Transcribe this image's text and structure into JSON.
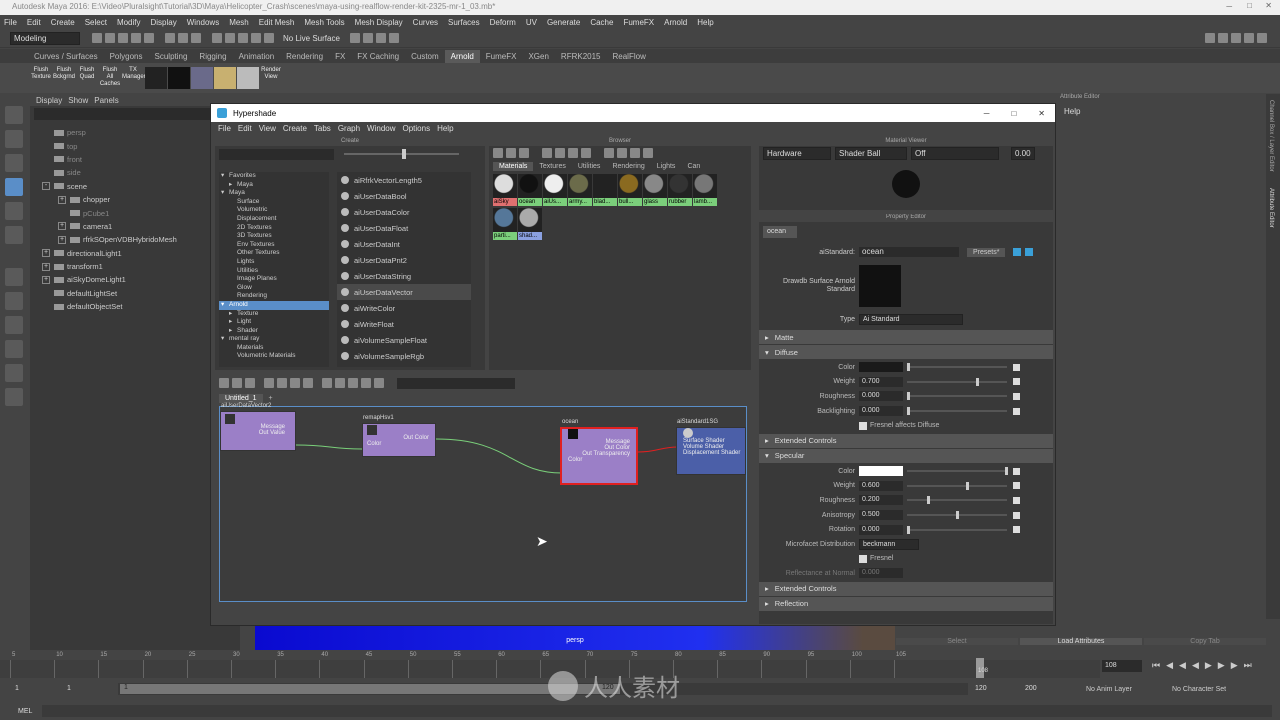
{
  "window_title": "Autodesk Maya 2016: E:\\Video\\Pluralsight\\Tutorial\\3D\\Maya\\Helicopter_Crash\\scenes\\maya-using-realflow-render-kit-2325-mr-1_03.mb*",
  "main_menu": [
    "File",
    "Edit",
    "Create",
    "Select",
    "Modify",
    "Display",
    "Windows",
    "Mesh",
    "Edit Mesh",
    "Mesh Tools",
    "Mesh Display",
    "Curves",
    "Surfaces",
    "Deform",
    "UV",
    "Generate",
    "Cache",
    "FumeFX",
    "Arnold",
    "Help"
  ],
  "menu_set": "Modeling",
  "live_surface": "No Live Surface",
  "shelf_tabs": [
    "Curves / Surfaces",
    "Polygons",
    "Sculpting",
    "Rigging",
    "Animation",
    "Rendering",
    "FX",
    "FX Caching",
    "Custom",
    "Arnold",
    "FumeFX",
    "XGen",
    "RFRK2015",
    "RealFlow"
  ],
  "active_shelf_tab": "Arnold",
  "shelf_buttons": [
    "Flush Texture",
    "Flush Bckgrnd",
    "Flush Quad",
    "Flush All Caches",
    "TX Manager",
    "",
    "",
    "",
    "",
    "",
    "Render View"
  ],
  "outliner": {
    "menu": [
      "Display",
      "Show",
      "Panels"
    ],
    "items": [
      "persp",
      "top",
      "front",
      "side",
      "scene",
      "chopper",
      "pCube1",
      "camera1",
      "rfrkSOpenVDBHybridoMesh",
      "directionalLight1",
      "transform1",
      "aiSkyDomeLight1",
      "defaultLightSet",
      "defaultObjectSet"
    ]
  },
  "hypershade": {
    "title": "Hypershade",
    "menu": [
      "File",
      "Edit",
      "View",
      "Create",
      "Tabs",
      "Graph",
      "Window",
      "Options",
      "Help"
    ],
    "create_panel_title": "Create",
    "browser_title": "Browser",
    "material_viewer_title": "Material Viewer",
    "property_editor_title": "Property Editor",
    "categories": [
      "Favorites",
      "Maya",
      "Maya",
      "Surface",
      "Volumetric",
      "Displacement",
      "2D Textures",
      "3D Textures",
      "Env Textures",
      "Other Textures",
      "Lights",
      "Utilities",
      "Image Planes",
      "Glow",
      "Rendering",
      "Arnold",
      "Texture",
      "Light",
      "Shader",
      "mental ray",
      "Materials",
      "Volumetric Materials"
    ],
    "selected_category": "Arnold",
    "node_list": [
      "aiRfrkVectorLength5",
      "aiUserDataBool",
      "aiUserDataColor",
      "aiUserDataFloat",
      "aiUserDataInt",
      "aiUserDataPnt2",
      "aiUserDataString",
      "aiUserDataVector",
      "aiWriteColor",
      "aiWriteFloat",
      "aiVolumeSampleFloat",
      "aiVolumeSampleRgb"
    ],
    "browser_tabs": [
      "Materials",
      "Textures",
      "Utilities",
      "Rendering",
      "Lights",
      "Can"
    ],
    "active_browser_tab": "Materials",
    "materials": [
      "aiSky",
      "ocean",
      "aiUs...",
      "army...",
      "blad...",
      "bull...",
      "glass",
      "rubber",
      "lamb...",
      "parti...",
      "shad..."
    ],
    "viewer": {
      "renderer": "Hardware",
      "geometry": "Shader Ball",
      "mode": "Off",
      "exposure": "0.00"
    },
    "graph_tabs": [
      "Untitled_1",
      "+"
    ],
    "nodes": {
      "n1": {
        "title": "aiUserDataVector2",
        "ports": [
          "Message",
          "Out Value"
        ]
      },
      "n2": {
        "title": "remapHsv1",
        "ports": [
          "Out Color",
          "Color"
        ]
      },
      "n3": {
        "title": "ocean",
        "ports": [
          "Message",
          "Out Color",
          "Out Transparency",
          "Color"
        ]
      },
      "n4": {
        "title": "aiStandard1SG",
        "ports": [
          "Surface Shader",
          "Volume Shader",
          "Displacement Shader"
        ]
      }
    },
    "property_editor": {
      "tab": "ocean",
      "node_type_label": "aiStandard:",
      "node_name": "ocean",
      "presets": "Presets*",
      "swatch_label": "Drawdb Surface Arnold Standard",
      "type_label": "Type",
      "type_value": "Ai Standard",
      "sections": {
        "matte": "Matte",
        "diffuse": "Diffuse",
        "extended1": "Extended Controls",
        "specular": "Specular",
        "extended2": "Extended Controls",
        "reflection": "Reflection"
      },
      "diffuse": [
        {
          "label": "Color",
          "value": ""
        },
        {
          "label": "Weight",
          "value": "0.700",
          "pos": 0.7
        },
        {
          "label": "Roughness",
          "value": "0.000",
          "pos": 0
        },
        {
          "label": "Backlighting",
          "value": "0.000",
          "pos": 0
        }
      ],
      "fresnel_affects_diffuse": "Fresnel affects Diffuse",
      "specular": [
        {
          "label": "Color",
          "value": ""
        },
        {
          "label": "Weight",
          "value": "0.600",
          "pos": 0.6
        },
        {
          "label": "Roughness",
          "value": "0.200",
          "pos": 0.2
        },
        {
          "label": "Anisotropy",
          "value": "0.500",
          "pos": 0.5
        },
        {
          "label": "Rotation",
          "value": "0.000",
          "pos": 0
        }
      ],
      "microfacet_label": "Microfacet Distribution",
      "microfacet_value": "beckmann",
      "fresnel": "Fresnel",
      "reflectance_label": "Reflectance at Normal",
      "reflectance_value": "0.000"
    }
  },
  "attribute_editor_title": "Attribute Editor",
  "attribute_editor_help": "Help",
  "side_tabs": [
    "Channel Box / Layer Editor",
    "Attribute Editor"
  ],
  "bottom_buttons": [
    "Select",
    "Load Attributes",
    "Copy Tab"
  ],
  "viewport_label": "persp",
  "timeline": {
    "ticks": [
      "5",
      "10",
      "15",
      "20",
      "25",
      "30",
      "35",
      "40",
      "45",
      "50",
      "55",
      "60",
      "65",
      "70",
      "75",
      "80",
      "85",
      "90",
      "95",
      "100",
      "105"
    ],
    "current_frame": "108",
    "current_frame_field": "108"
  },
  "range": {
    "start": "1",
    "start2": "1",
    "slider_start": "1",
    "slider_end": "120",
    "end": "120",
    "end2": "200",
    "anim_layer": "No Anim Layer",
    "character_set": "No Character Set"
  },
  "command_line_label": "MEL",
  "watermark": "人人素材",
  "colors": {
    "node_purple": "#9b7fc7",
    "node_blue": "#4b5fa8",
    "selected_red": "#e02020",
    "wire_green": "#7ad07a",
    "label_green": "#7bcf7b",
    "selection_blue": "#5a8ec8"
  }
}
